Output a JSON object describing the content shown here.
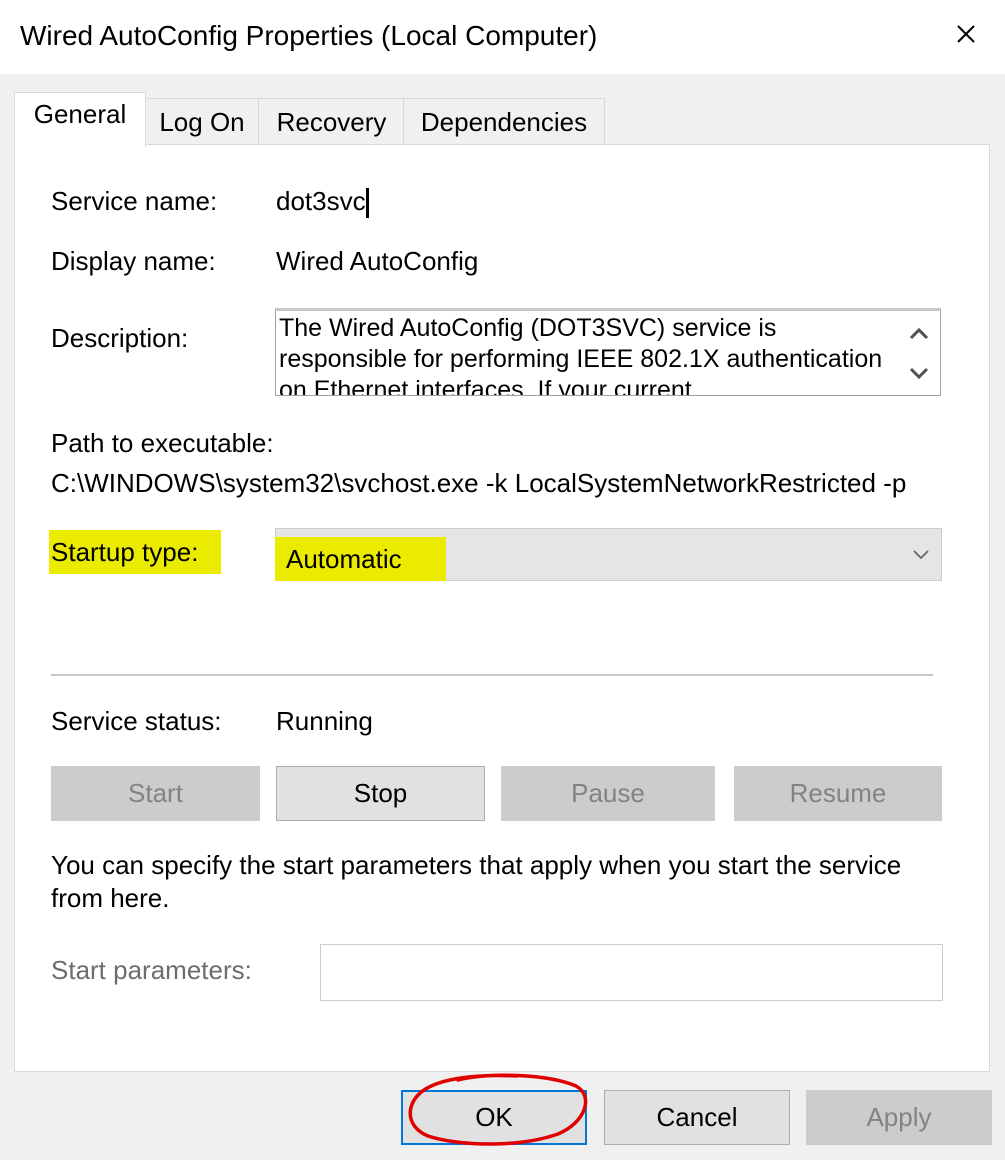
{
  "window": {
    "title": "Wired AutoConfig Properties (Local Computer)"
  },
  "tabs": [
    {
      "label": "General",
      "active": true
    },
    {
      "label": "Log On"
    },
    {
      "label": "Recovery"
    },
    {
      "label": "Dependencies"
    }
  ],
  "general": {
    "service_name_label": "Service name:",
    "service_name_value": "dot3svc",
    "display_name_label": "Display name:",
    "display_name_value": "Wired AutoConfig",
    "description_label": "Description:",
    "description_value": "The Wired AutoConfig (DOT3SVC) service is responsible for performing IEEE 802.1X authentication on Ethernet interfaces. If your current",
    "path_label": "Path to executable:",
    "path_value": "C:\\WINDOWS\\system32\\svchost.exe -k LocalSystemNetworkRestricted -p",
    "startup_type_label": "Startup type:",
    "startup_type_value": "Automatic",
    "service_status_label": "Service status:",
    "service_status_value": "Running",
    "buttons": {
      "start": "Start",
      "stop": "Stop",
      "pause": "Pause",
      "resume": "Resume"
    },
    "help_text": "You can specify the start parameters that apply when you start the service from here.",
    "start_params_label": "Start parameters:",
    "start_params_value": ""
  },
  "footer": {
    "ok": "OK",
    "cancel": "Cancel",
    "apply": "Apply"
  },
  "colors": {
    "highlight": "#ebeb00",
    "annotation_circle": "#e00000",
    "focus_border": "#0078d7"
  }
}
